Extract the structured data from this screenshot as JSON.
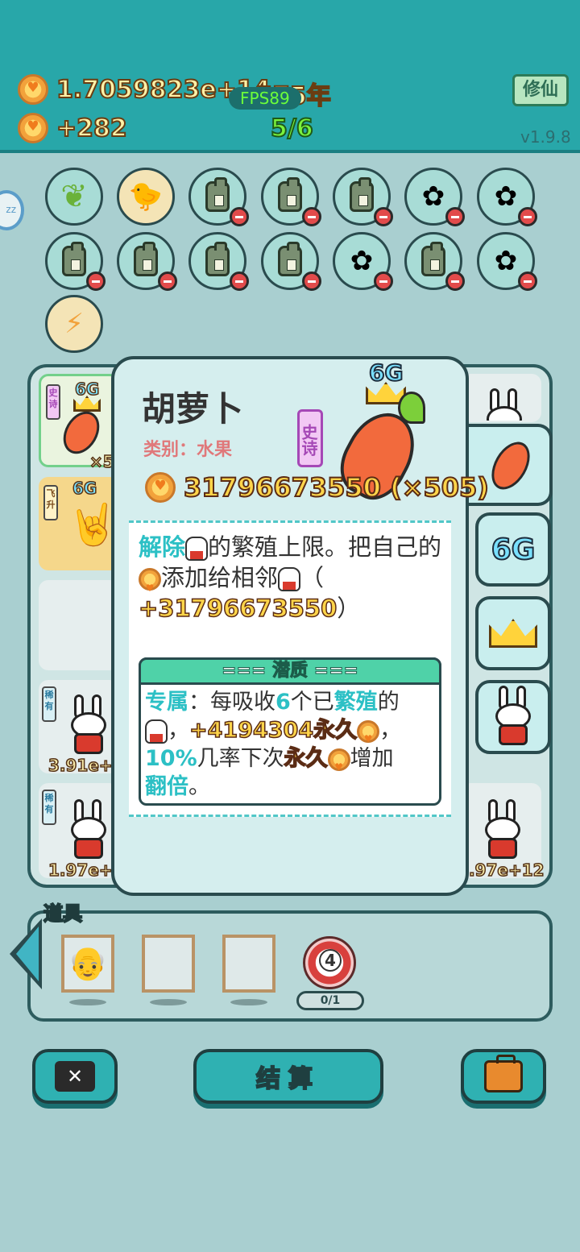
{
  "header": {
    "coins_total": "1.7059823e+14",
    "year": "575年",
    "fps": "FPS89",
    "coins_rate": "+282",
    "progress": "5/6",
    "mode_button": "修仙",
    "version": "v1.9.8"
  },
  "zz": "zz",
  "board": {
    "left_card_multiplier": "×5",
    "left_card_tag": "史诗",
    "left_card_6g": "6G",
    "second_card_tag": "飞升",
    "second_card_6g": "6G",
    "rare_tag_1": "稀有",
    "rare_value_1": "3.91e+",
    "rare_tag_2": "稀有",
    "rare_value_2": "1.97e+",
    "right_value_partial": ".97e+12",
    "right_value_partial_2": ".9.. +12"
  },
  "popup": {
    "title": "胡萝卜",
    "category": "类别：水果",
    "rarity": "史诗",
    "level": "6G",
    "value": "31796673550 (×505)",
    "desc_hl1": "解除",
    "desc_part1": "的繁殖上限。把自己的",
    "desc_part2": "添加给相邻",
    "desc_part3": "（",
    "desc_value": "+31796673550",
    "desc_part4": "）",
    "potential_title": "=== 潜质 ===",
    "pot_hl1": "专属",
    "pot_part1": "：每吸收",
    "pot_hl2": "6",
    "pot_part2": "个已",
    "pot_hl3": "繁殖",
    "pot_part3": "的",
    "pot_part4": "，",
    "pot_value1": "+4194304永久",
    "pot_part5": "，",
    "pot_hl4": "10%",
    "pot_part6": "几率下次",
    "pot_value2": "永久",
    "pot_part7": "增加",
    "pot_hl5": "翻倍",
    "pot_part8": "。"
  },
  "side_tabs": {
    "tab_6g": "6G"
  },
  "items": {
    "label": "道具",
    "target_number": "4",
    "target_count": "0/1"
  },
  "buttons": {
    "settle": "结算",
    "close_icon_text": "✕"
  },
  "colors": {
    "header_bg": "#28a7a9",
    "accent_teal": "#2cc0c5",
    "gold": "#ffd54a",
    "rarity_purple": "#a548b6"
  }
}
